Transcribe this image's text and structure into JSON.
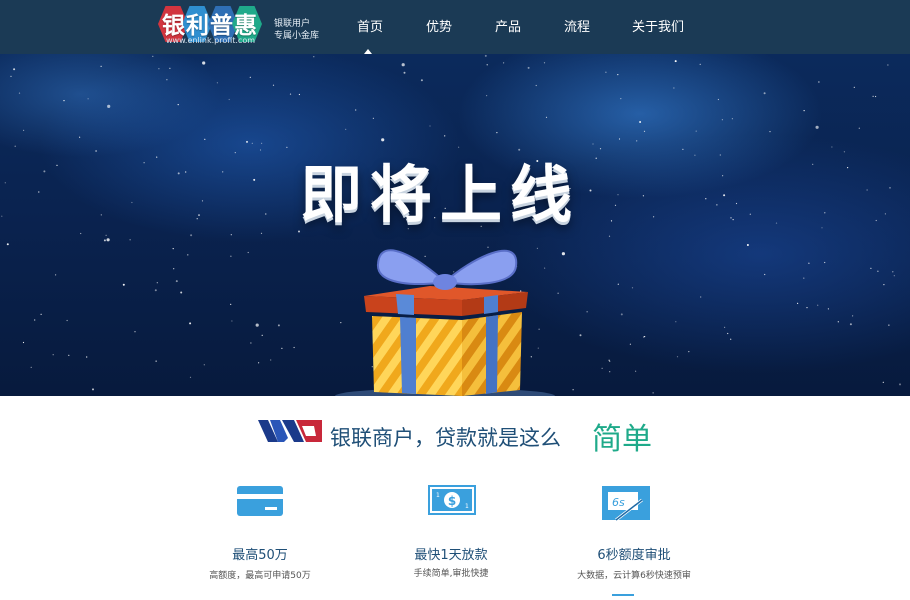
{
  "header": {
    "logo": {
      "brand": "银利普惠",
      "url": "www.enlink.profit.com",
      "tagline_1": "银联用户",
      "tagline_2": "专属小金库"
    },
    "nav": [
      {
        "label": "首页",
        "active": true
      },
      {
        "label": "优势",
        "active": false
      },
      {
        "label": "产品",
        "active": false
      },
      {
        "label": "流程",
        "active": false
      },
      {
        "label": "关于我们",
        "active": false
      }
    ]
  },
  "banner": {
    "title": "即将上线"
  },
  "slogan": {
    "text": "银联商户，贷款就是这么",
    "highlight": "简单"
  },
  "features": [
    {
      "icon": "credit-card-icon",
      "title": "最高50万",
      "desc": "高额度，最高可申请50万"
    },
    {
      "icon": "banknote-icon",
      "title": "最快1天放款",
      "desc": "手续简单,审批快捷"
    },
    {
      "icon": "stopwatch-6s-icon",
      "title": "6秒额度审批",
      "desc": "大数据，云计算6秒快速预审"
    }
  ],
  "colors": {
    "header_bg": "#1b3a55",
    "accent_blue": "#3aa0dd",
    "accent_green": "#1faa8a",
    "text_blue": "#1f4f77"
  }
}
